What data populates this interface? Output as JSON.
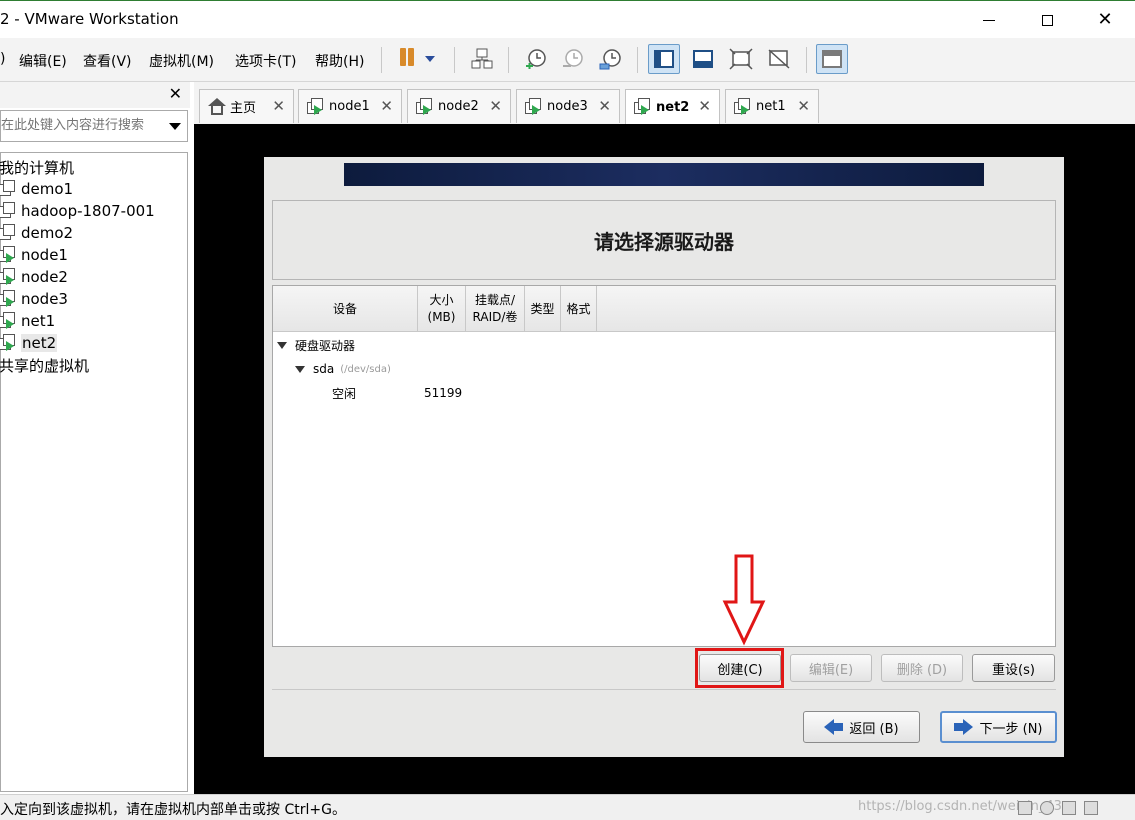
{
  "window": {
    "title": "2 - VMware Workstation",
    "minimize": "minimize",
    "maximize": "maximize",
    "close": "✕"
  },
  "menu": [
    {
      "label": ")"
    },
    {
      "label": "编辑(E)"
    },
    {
      "label": "查看(V)"
    },
    {
      "label": "虚拟机(M)"
    },
    {
      "label": "选项卡(T)"
    },
    {
      "label": "帮助(H)"
    }
  ],
  "library": {
    "close": "✕",
    "search_placeholder": "在此处键入内容进行搜索",
    "tree": [
      {
        "label": "我的计算机",
        "type": "group"
      },
      {
        "label": "demo1",
        "type": "vm",
        "running": false
      },
      {
        "label": "hadoop-1807-001",
        "type": "vm",
        "running": false
      },
      {
        "label": "demo2",
        "type": "vm",
        "running": false
      },
      {
        "label": "node1",
        "type": "vm",
        "running": true
      },
      {
        "label": "node2",
        "type": "vm",
        "running": true
      },
      {
        "label": "node3",
        "type": "vm",
        "running": true
      },
      {
        "label": "net1",
        "type": "vm",
        "running": true
      },
      {
        "label": "net2",
        "type": "vm",
        "running": true,
        "selected": true
      },
      {
        "label": "共享的虚拟机",
        "type": "group"
      }
    ]
  },
  "tabs": [
    {
      "label": "主页",
      "icon": "home-icon",
      "active": false
    },
    {
      "label": "node1",
      "icon": "vm-running-icon",
      "active": false
    },
    {
      "label": "node2",
      "icon": "vm-running-icon",
      "active": false
    },
    {
      "label": "node3",
      "icon": "vm-running-icon",
      "active": false
    },
    {
      "label": "net2",
      "icon": "vm-running-icon",
      "active": true
    },
    {
      "label": "net1",
      "icon": "vm-running-icon",
      "active": false
    }
  ],
  "installer": {
    "heading": "请选择源驱动器",
    "columns": {
      "device": "设备",
      "size_line1": "大小",
      "size_line2": "(MB)",
      "mount_line1": "挂载点/",
      "mount_line2": "RAID/卷",
      "type": "类型",
      "format": "格式"
    },
    "rows": {
      "group": "硬盘驱动器",
      "disk": "sda",
      "disk_path": "(/dev/sda)",
      "free_label": "空闲",
      "free_size": "51199"
    },
    "buttons": {
      "create": "创建(C)",
      "edit": "编辑(E)",
      "delete": "删除 (D)",
      "reset": "重设(s)",
      "back": "返回 (B)",
      "next": "下一步 (N)"
    }
  },
  "status": {
    "message": "入定向到该虚拟机，请在虚拟机内部单击或按 Ctrl+G。",
    "watermark": "https://blog.csdn.net/weixin_43"
  },
  "colors": {
    "highlight": "#e01616",
    "banner": "#0d1b3d",
    "running": "#2fa84f"
  }
}
